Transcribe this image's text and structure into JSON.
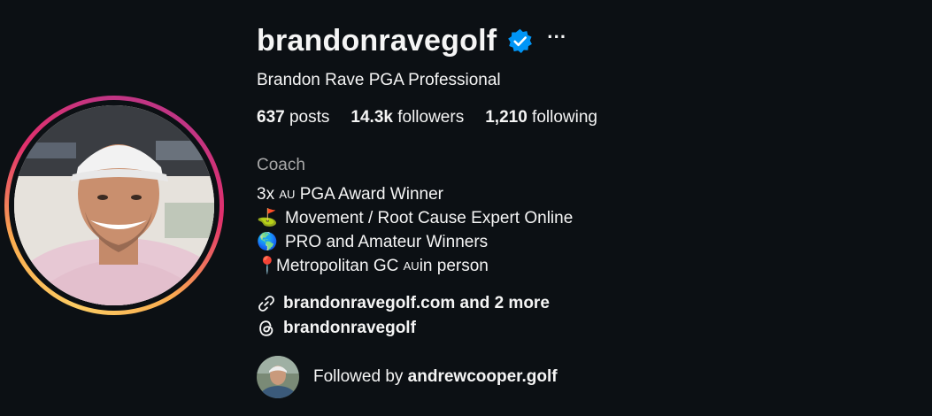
{
  "profile": {
    "username": "brandonravegolf",
    "more_label": "···",
    "full_name": "Brandon Rave PGA Professional",
    "stats": {
      "posts_count": "637",
      "posts_label": "posts",
      "followers_count": "14.3k",
      "followers_label": "followers",
      "following_count": "1,210",
      "following_label": "following"
    },
    "category": "Coach",
    "bio": {
      "line1_prefix": "3x ",
      "line1_au": "AU",
      "line1_suffix": " PGA Award Winner",
      "line2_emoji": "⛳",
      "line2_text": "Movement / Root Cause Expert Online",
      "line3_emoji": "🌎",
      "line3_text": "PRO and Amateur Winners",
      "line4_emoji": "📍",
      "line4_prefix": "Metropolitan GC ",
      "line4_au": "AU",
      "line4_suffix": "in person"
    },
    "links": {
      "website_text": "brandonravegolf.com and 2 more",
      "threads_text": "brandonravegolf"
    },
    "followed_by": {
      "prefix": "Followed by ",
      "username": "andrewcooper.golf"
    },
    "icons": {
      "verified": "verified-badge-icon",
      "link": "link-icon",
      "threads": "threads-icon"
    },
    "colors": {
      "background": "#0c1014",
      "verified": "#0095f6",
      "secondary_text": "#a8a8a8"
    }
  }
}
